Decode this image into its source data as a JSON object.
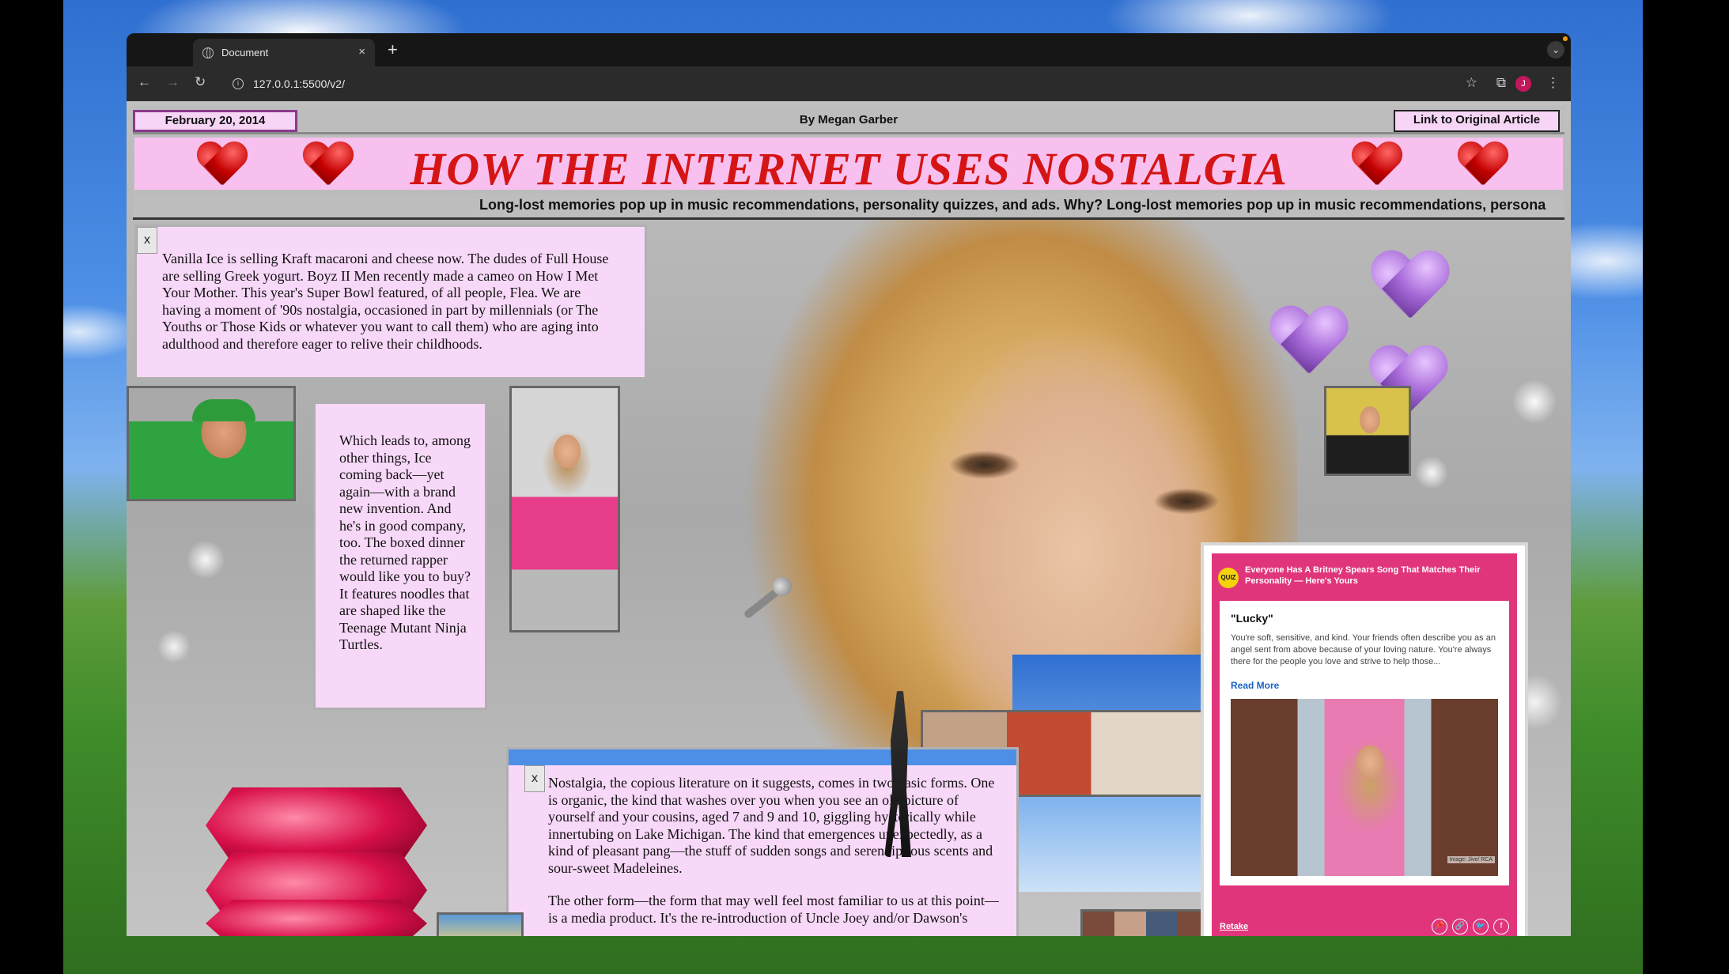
{
  "browser": {
    "tab_title": "Document",
    "tab_close": "×",
    "new_tab": "+",
    "url": "127.0.0.1:5500/v2/",
    "avatar_letter": "J",
    "tab_menu": "⌄"
  },
  "header": {
    "date": "February 20, 2014",
    "byline": "By Megan Garber",
    "link_label": "Link to Original Article"
  },
  "headline": "HOW THE INTERNET USES NOSTALGIA",
  "ticker": "Long-lost memories pop up in music recommendations, personality quizzes, and ads. Why? Long-lost memories pop up in music recommendations, persona",
  "boxes": {
    "close_label": "x",
    "p1": "Vanilla Ice is selling Kraft macaroni and cheese now. The dudes of Full House are selling Greek yogurt. Boyz II Men recently made a cameo on How I Met Your Mother. This year's Super Bowl featured, of all people, Flea. We are having a moment of '90s nostalgia, occasioned in part by millennials (or The Youths or Those Kids or whatever you want to call them) who are aging into adulthood and therefore eager to relive their childhoods.",
    "p2": "Which leads to, among other things, Ice coming back—yet again—with a brand new invention. And he's in good company, too. The boxed dinner the returned rapper would like you to buy? It features noodles that are shaped like the Teenage Mutant Ninja Turtles.",
    "p3a": "Nostalgia, the copious literature on it suggests, comes in two basic forms. One is organic, the kind that washes over you when you see an old picture of yourself and your cousins, aged 7 and 9 and 10, giggling hysterically while innertubing on Lake Michigan. The kind that emergences unexpectedly, as a kind of pleasant pang—the stuff of sudden songs and serendipitous scents and sour-sweet Madeleines.",
    "p3b": "The other form—the form that may well feel most familiar to us at this point—is a media product. It's the re-introduction of Uncle Joey and/or Dawson's"
  },
  "quiz": {
    "badge": "QUIZ",
    "title": "Everyone Has A Britney Spears Song That Matches Their Personality — Here's Yours",
    "result": "\"Lucky\"",
    "description": "You're soft, sensitive, and kind. Your friends often describe you as an angel sent from above because of your loving nature. You're always there for the people you love and strive to help those...",
    "read_more": "Read More",
    "image_credit": "Image: Jive/ RCA",
    "retake": "Retake",
    "share_icons": [
      "📌",
      "🔗",
      "🐦",
      "f"
    ]
  }
}
